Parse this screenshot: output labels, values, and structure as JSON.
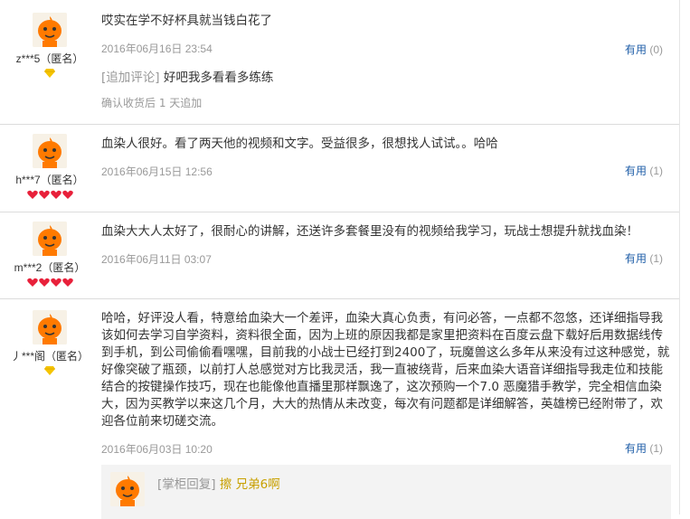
{
  "reviews": [
    {
      "username": "z***5（匿名）",
      "rank_icon": "gold-diamond-icon",
      "rank_count": 1,
      "text": "哎实在学不好杯具就当钱白花了",
      "date": "2016年06月16日  23:54",
      "useful_label": "有用",
      "useful_count": "(0)",
      "append_tag": "[追加评论]",
      "append_text": "好吧我多看看多练练",
      "append_note": "确认收货后 1 天追加"
    },
    {
      "username": "h***7（匿名）",
      "rank_icon": "red-heart-icon",
      "rank_count": 4,
      "text": "血染人很好。看了两天他的视频和文字。受益很多，很想找人试试。。哈哈",
      "date": "2016年06月15日  12:56",
      "useful_label": "有用",
      "useful_count": "(1)"
    },
    {
      "username": "m***2（匿名）",
      "rank_icon": "red-heart-icon",
      "rank_count": 4,
      "text": "血染大大人太好了，很耐心的讲解，还送许多套餐里没有的视频给我学习，玩战士想提升就找血染！",
      "date": "2016年06月11日  03:07",
      "useful_label": "有用",
      "useful_count": "(1)"
    },
    {
      "username": "丿***阁（匿名）",
      "rank_icon": "gold-diamond-icon",
      "rank_count": 1,
      "text": "哈哈，好评没人看，特意给血染大一个差评，血染大真心负责，有问必答，一点都不忽悠，还详细指导我该如何去学习自学资料，资料很全面，因为上班的原因我都是家里把资料在百度云盘下载好后用数据线传到手机，到公司偷偷看嘿嘿，目前我的小战士已经打到2400了，玩魔兽这么多年从来没有过这种感觉，就好像突破了瓶颈，以前打人总感觉对方比我灵活，我一直被绕背，后来血染大语音详细指导我走位和技能结合的按键操作技巧，现在也能像他直播里那样飘逸了，这次预购一个7.0 恶魔猎手教学，完全相信血染大，因为买教学以来这几个月，大大的热情从未改变，每次有问题都是详细解答，英雄榜已经附带了，欢迎各位前来切磋交流。",
      "date": "2016年06月03日  10:20",
      "useful_label": "有用",
      "useful_count": "(1)",
      "reply_tag": "[掌柜回复]",
      "reply_text": "擦 兄弟6啊"
    }
  ],
  "colors": {
    "link_blue": "#1f5ea8",
    "meta_gray": "#999999",
    "reply_gold": "#c8a000",
    "divider": "#dcdcdc"
  }
}
